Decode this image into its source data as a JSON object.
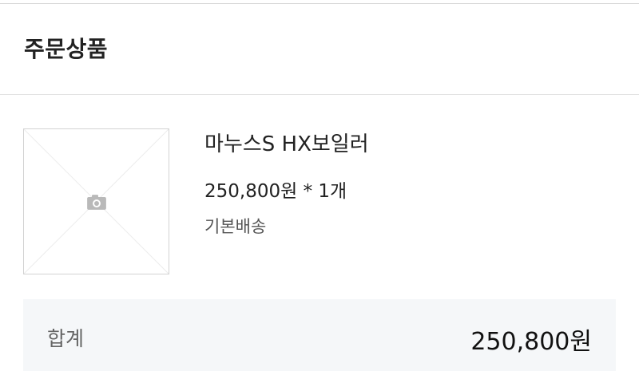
{
  "section": {
    "title": "주문상품"
  },
  "product": {
    "image_icon": "camera-icon",
    "name": "마누스S HX보일러",
    "price_qty": "250,800원 * 1개",
    "shipping": "기본배송"
  },
  "summary": {
    "label": "합계",
    "total": "250,800원"
  },
  "colors": {
    "border": "#d6d6d6",
    "summary_bg": "#f5f7f9",
    "text": "#222222",
    "muted": "#666666"
  }
}
